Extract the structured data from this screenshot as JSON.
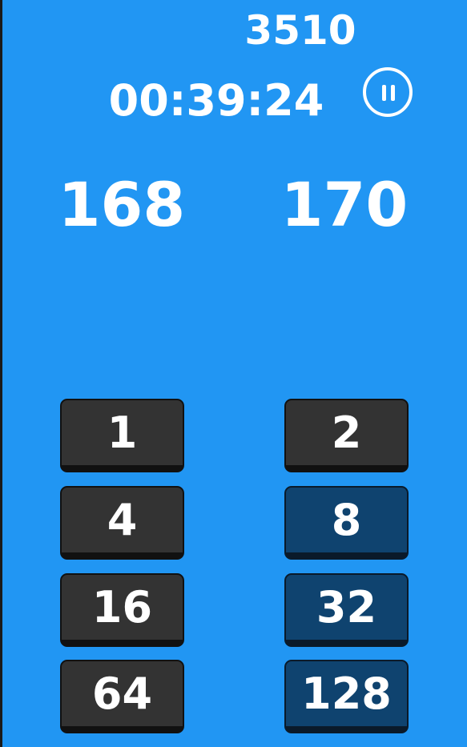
{
  "header": {
    "score": "3510",
    "timer": "00:39:24"
  },
  "targets": {
    "left": "168",
    "right": "170"
  },
  "colors": {
    "background": "#2196F3",
    "button_off": "#333333",
    "button_on": "#0f436f"
  },
  "icons": {
    "pause": "pause-circle-icon"
  },
  "buttons": [
    {
      "label": "1",
      "active": false
    },
    {
      "label": "2",
      "active": false
    },
    {
      "label": "4",
      "active": false
    },
    {
      "label": "8",
      "active": true
    },
    {
      "label": "16",
      "active": false
    },
    {
      "label": "32",
      "active": true
    },
    {
      "label": "64",
      "active": false
    },
    {
      "label": "128",
      "active": true
    }
  ]
}
